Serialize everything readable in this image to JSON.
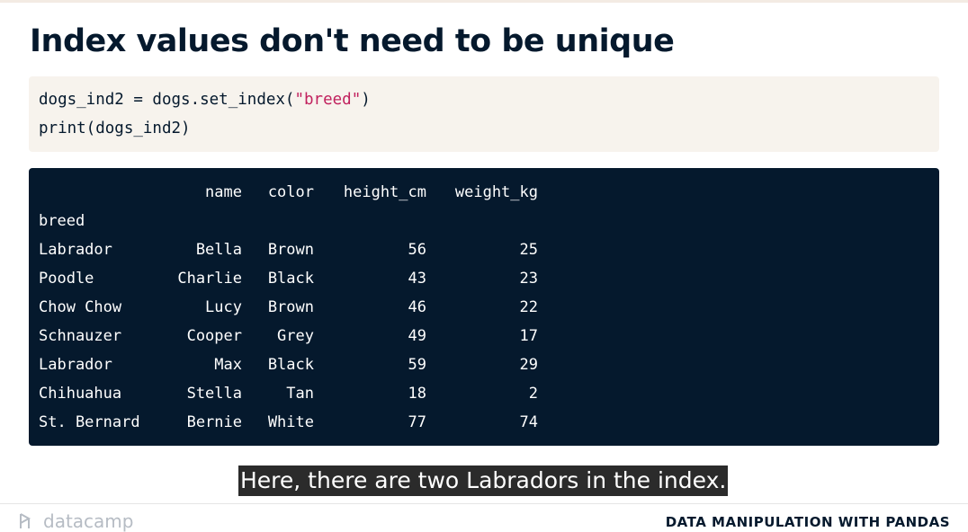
{
  "slide": {
    "title": "Index values don't need to be unique"
  },
  "code": {
    "line1_before": "dogs_ind2 = dogs.set_index(",
    "line1_string": "\"breed\"",
    "line1_after": ")",
    "line2": "print(dogs_ind2)"
  },
  "output": {
    "index_name": "breed",
    "columns": [
      "name",
      "color",
      "height_cm",
      "weight_kg"
    ],
    "rows": [
      {
        "breed": "Labrador",
        "name": "Bella",
        "color": "Brown",
        "height_cm": "56",
        "weight_kg": "25"
      },
      {
        "breed": "Poodle",
        "name": "Charlie",
        "color": "Black",
        "height_cm": "43",
        "weight_kg": "23"
      },
      {
        "breed": "Chow Chow",
        "name": "Lucy",
        "color": "Brown",
        "height_cm": "46",
        "weight_kg": "22"
      },
      {
        "breed": "Schnauzer",
        "name": "Cooper",
        "color": "Grey",
        "height_cm": "49",
        "weight_kg": "17"
      },
      {
        "breed": "Labrador",
        "name": "Max",
        "color": "Black",
        "height_cm": "59",
        "weight_kg": "29"
      },
      {
        "breed": "Chihuahua",
        "name": "Stella",
        "color": "Tan",
        "height_cm": "18",
        "weight_kg": "2"
      },
      {
        "breed": "St. Bernard",
        "name": "Bernie",
        "color": "White",
        "height_cm": "77",
        "weight_kg": "74"
      }
    ]
  },
  "caption": {
    "text": "Here, there are two Labradors in the index."
  },
  "footer": {
    "logo_text": "datacamp",
    "course_title": "DATA MANIPULATION WITH PANDAS"
  },
  "colors": {
    "title": "#05192d",
    "code_bg": "#f7f3ed",
    "string": "#c1215e",
    "output_bg": "#05192d"
  }
}
